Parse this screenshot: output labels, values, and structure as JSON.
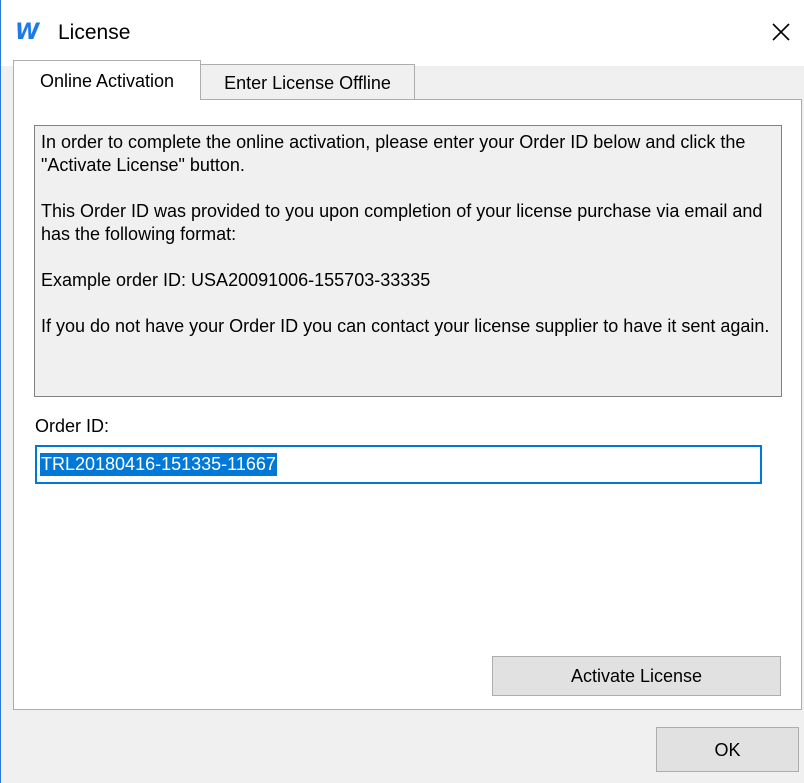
{
  "window": {
    "logo": "W",
    "title": "License",
    "close_label": "×"
  },
  "tabs": [
    {
      "label": "Online Activation",
      "active": true
    },
    {
      "label": "Enter License Offline",
      "active": false
    }
  ],
  "info": {
    "paragraph1": "In order to complete the online activation, please enter your Order ID below and click the \"Activate License\" button.",
    "paragraph2": "This Order ID was provided to you upon completion of your license purchase via email and has the following format:",
    "paragraph3": "Example order ID: USA20091006-155703-33335",
    "paragraph4": "If you do not have your Order ID you can contact your license supplier to have it sent again."
  },
  "order": {
    "label": "Order ID:",
    "value": "TRL20180416-151335-11667"
  },
  "buttons": {
    "activate": "Activate License",
    "ok": "OK"
  },
  "colors": {
    "accent": "#0078d7",
    "window_border": "#2b79d8",
    "logo": "#1e7be6",
    "dialog_background": "#f0f0f0"
  }
}
